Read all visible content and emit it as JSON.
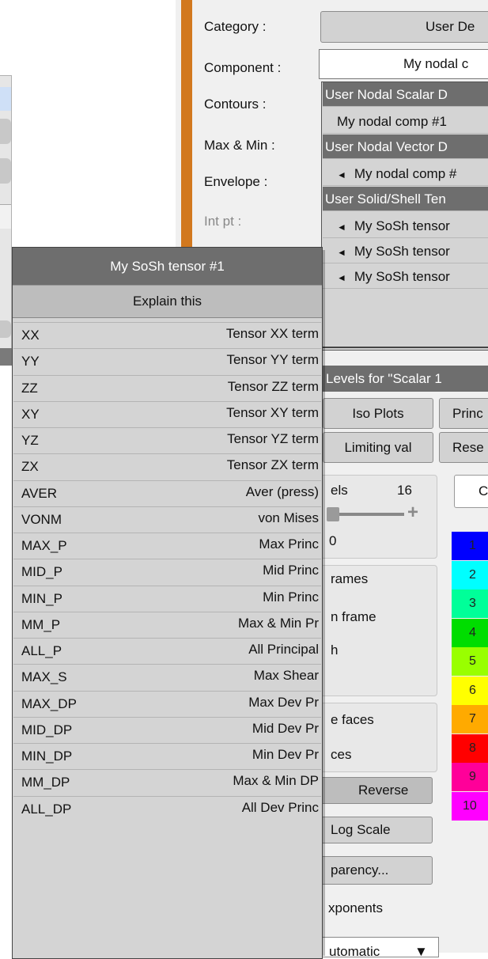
{
  "form": {
    "category_label": "Category :",
    "category_value": "User De",
    "component_label": "Component :",
    "component_value": "My nodal c",
    "contours_label": "Contours :",
    "maxmin_label": "Max & Min :",
    "envelope_label": "Envelope :",
    "intpt_label": "Int pt :"
  },
  "component_list": [
    {
      "text": "User Nodal Scalar D",
      "type": "header"
    },
    {
      "text": "My nodal comp #1",
      "type": "plain"
    },
    {
      "text": "User Nodal Vector D",
      "type": "header"
    },
    {
      "text": "My nodal comp #",
      "type": "group"
    },
    {
      "text": "User Solid/Shell Ten",
      "type": "header"
    },
    {
      "text": "My SoSh tensor",
      "type": "group"
    },
    {
      "text": "My SoSh tensor",
      "type": "group"
    },
    {
      "text": "My SoSh tensor",
      "type": "group"
    }
  ],
  "popup": {
    "title": "My SoSh tensor #1",
    "explain": "Explain this",
    "rows": [
      {
        "key": "XX",
        "desc": "Tensor XX term"
      },
      {
        "key": "YY",
        "desc": "Tensor YY term"
      },
      {
        "key": "ZZ",
        "desc": "Tensor ZZ term"
      },
      {
        "key": "XY",
        "desc": "Tensor XY term"
      },
      {
        "key": "YZ",
        "desc": "Tensor YZ term"
      },
      {
        "key": "ZX",
        "desc": "Tensor ZX term"
      },
      {
        "key": "AVER",
        "desc": "Aver (press)"
      },
      {
        "key": "VONM",
        "desc": "von Mises"
      },
      {
        "key": "MAX_P",
        "desc": "Max Princ"
      },
      {
        "key": "MID_P",
        "desc": "Mid Princ"
      },
      {
        "key": "MIN_P",
        "desc": "Min Princ"
      },
      {
        "key": "MM_P",
        "desc": "Max & Min Pr"
      },
      {
        "key": "ALL_P",
        "desc": "All Principal"
      },
      {
        "key": "MAX_S",
        "desc": "Max Shear"
      },
      {
        "key": "MAX_DP",
        "desc": "Max Dev Pr"
      },
      {
        "key": "MID_DP",
        "desc": "Mid Dev Pr"
      },
      {
        "key": "MIN_DP",
        "desc": "Min Dev Pr"
      },
      {
        "key": "MM_DP",
        "desc": "Max & Min DP"
      },
      {
        "key": "ALL_DP",
        "desc": "All Dev Princ"
      }
    ]
  },
  "levels": {
    "header": "Levels for \"Scalar 1",
    "tabs": [
      "Iso Plots",
      "Princ",
      "Limiting val",
      "Rese"
    ],
    "levels_label": "els",
    "levels_count": "16",
    "plus": "+",
    "value_zero": "0",
    "frames_1": "rames",
    "frames_2": "n frame",
    "faces_1": "e faces",
    "faces_2": "ces",
    "reverse": "Reverse",
    "log_scale": "Log Scale",
    "transparency": "parency...",
    "exponents": "xponents",
    "automatic": "utomatic",
    "c_button": "C",
    "dropdown_arrow": "▼"
  },
  "color_bands": [
    {
      "n": "1",
      "color": "#0000ff"
    },
    {
      "n": "2",
      "color": "#00ffff"
    },
    {
      "n": "3",
      "color": "#00ff99"
    },
    {
      "n": "4",
      "color": "#00dd00"
    },
    {
      "n": "5",
      "color": "#99ff00"
    },
    {
      "n": "6",
      "color": "#ffff00"
    },
    {
      "n": "7",
      "color": "#ffaa00"
    },
    {
      "n": "8",
      "color": "#ff0000"
    },
    {
      "n": "9",
      "color": "#ff0099"
    },
    {
      "n": "10",
      "color": "#ff00ff"
    }
  ],
  "accent": "#d2781e"
}
